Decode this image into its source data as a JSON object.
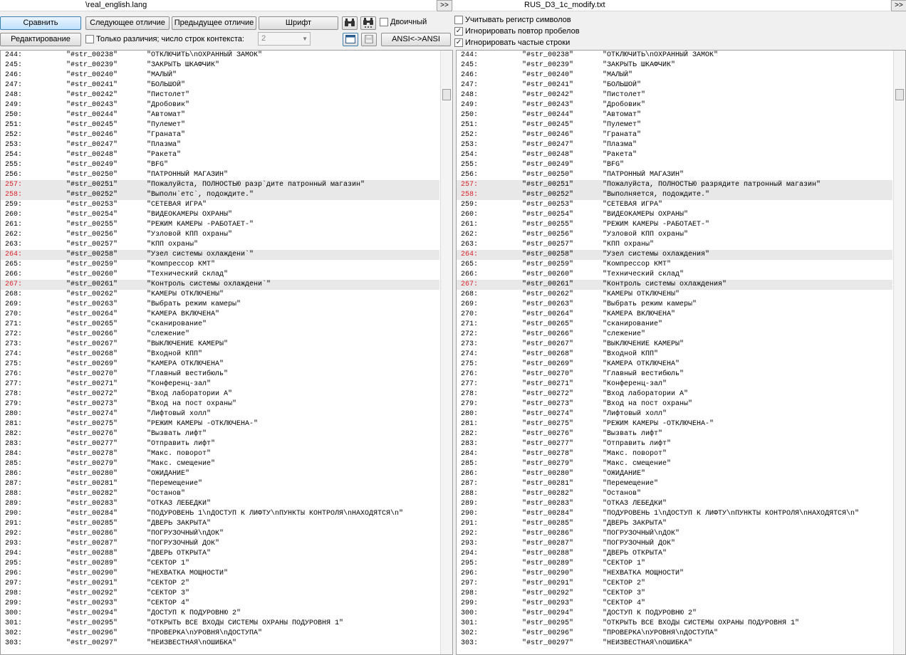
{
  "left_path": "\\real_english.lang",
  "right_path": "RUS_D3_1c_modify.txt",
  "swap_label": ">>",
  "toolbar": {
    "compare": "Сравнить",
    "next_diff": "Следующее отличие",
    "prev_diff": "Предыдущее отличие",
    "font": "Шрифт",
    "edit": "Редактирование",
    "only_diff_label": "Только различия; число строк контекста:",
    "context_value": "2",
    "binary_label": "Двоичный",
    "ansi": "ANSI<->ANSI",
    "find_icon": "binoculars-icon",
    "find_next_icon": "binoculars-next-icon",
    "window_icon": "window-icon",
    "save_icon": "floppy-disk-icon"
  },
  "options": {
    "case_sensitive": "Учитывать регистр символов",
    "ignore_spaces": "Игнорировать повтор пробелов",
    "ignore_frequent": "Игнорировать частые строки"
  },
  "colors": {
    "diff_num": "#d8222a",
    "diff_char": "#e0262e",
    "diff_bg": "#e8e8e8"
  },
  "left_lines": [
    [
      "244:",
      "\"#str_00238\"",
      "\"ОТКЛЮЧИТЬ\\nОХРАННЫЙ ЗАМОК\""
    ],
    [
      "245:",
      "\"#str_00239\"",
      "\"ЗАКРЫТЬ ШКАФЧИК\""
    ],
    [
      "246:",
      "\"#str_00240\"",
      "\"МАЛЫЙ\""
    ],
    [
      "247:",
      "\"#str_00241\"",
      "\"БОЛЬШОЙ\""
    ],
    [
      "248:",
      "\"#str_00242\"",
      "\"Пистолет\""
    ],
    [
      "249:",
      "\"#str_00243\"",
      "\"Дробовик\""
    ],
    [
      "250:",
      "\"#str_00244\"",
      "\"Автомат\""
    ],
    [
      "251:",
      "\"#str_00245\"",
      "\"Пулемет\""
    ],
    [
      "252:",
      "\"#str_00246\"",
      "\"Граната\""
    ],
    [
      "253:",
      "\"#str_00247\"",
      "\"Плазма\""
    ],
    [
      "254:",
      "\"#str_00248\"",
      "\"Ракета\""
    ],
    [
      "255:",
      "\"#str_00249\"",
      "\"BFG\""
    ],
    [
      "256:",
      "\"#str_00250\"",
      "\"ПАТРОННЫЙ МАГАЗИН\""
    ],
    [
      "257:",
      "\"#str_00251\"",
      "\"Пожалуйста, ПОЛНОСТЬЮ разр`дите патронный магазин\""
    ],
    [
      "258:",
      "\"#str_00252\"",
      "\"Выполн`етс`, подождите.\""
    ],
    [
      "259:",
      "\"#str_00253\"",
      "\"СЕТЕВАЯ ИГРА\""
    ],
    [
      "260:",
      "\"#str_00254\"",
      "\"ВИДЕОКАМЕРЫ ОХРАНЫ\""
    ],
    [
      "261:",
      "\"#str_00255\"",
      "\"РЕЖИМ КАМЕРЫ -РАБОТАЕТ-\""
    ],
    [
      "262:",
      "\"#str_00256\"",
      "\"Узловой КПП охраны\""
    ],
    [
      "263:",
      "\"#str_00257\"",
      "\"КПП охраны\""
    ],
    [
      "264:",
      "\"#str_00258\"",
      "\"Узел системы охлаждени`\""
    ],
    [
      "265:",
      "\"#str_00259\"",
      "\"Компрессор КМТ\""
    ],
    [
      "266:",
      "\"#str_00260\"",
      "\"Технический склад\""
    ],
    [
      "267:",
      "\"#str_00261\"",
      "\"Контроль системы охлаждени`\""
    ],
    [
      "268:",
      "\"#str_00262\"",
      "\"КАМЕРЫ ОТКЛЮЧЕНЫ\""
    ],
    [
      "269:",
      "\"#str_00263\"",
      "\"Выбрать режим камеры\""
    ],
    [
      "270:",
      "\"#str_00264\"",
      "\"КАМЕРА ВКЛЮЧЕНА\""
    ],
    [
      "271:",
      "\"#str_00265\"",
      "\"сканирование\""
    ],
    [
      "272:",
      "\"#str_00266\"",
      "\"слежение\""
    ],
    [
      "273:",
      "\"#str_00267\"",
      "\"ВЫКЛЮЧЕНИЕ КАМЕРЫ\""
    ],
    [
      "274:",
      "\"#str_00268\"",
      "\"Входной КПП\""
    ],
    [
      "275:",
      "\"#str_00269\"",
      "\"КАМЕРА ОТКЛЮЧЕНА\""
    ],
    [
      "276:",
      "\"#str_00270\"",
      "\"Главный вестибюль\""
    ],
    [
      "277:",
      "\"#str_00271\"",
      "\"Конференц-зал\""
    ],
    [
      "278:",
      "\"#str_00272\"",
      "\"Вход лаборатории А\""
    ],
    [
      "279:",
      "\"#str_00273\"",
      "\"Вход на пост охраны\""
    ],
    [
      "280:",
      "\"#str_00274\"",
      "\"Лифтовый холл\""
    ],
    [
      "281:",
      "\"#str_00275\"",
      "\"РЕЖИМ КАМЕРЫ -ОТКЛЮЧЕНА-\""
    ],
    [
      "282:",
      "\"#str_00276\"",
      "\"Вызвать лифт\""
    ],
    [
      "283:",
      "\"#str_00277\"",
      "\"Отправить лифт\""
    ],
    [
      "284:",
      "\"#str_00278\"",
      "\"Макс. поворот\""
    ],
    [
      "285:",
      "\"#str_00279\"",
      "\"Макс. смещение\""
    ],
    [
      "286:",
      "\"#str_00280\"",
      "\"ОЖИДАНИЕ\""
    ],
    [
      "287:",
      "\"#str_00281\"",
      "\"Перемещение\""
    ],
    [
      "288:",
      "\"#str_00282\"",
      "\"Останов\""
    ],
    [
      "289:",
      "\"#str_00283\"",
      "\"ОТКАЗ ЛЕБЕДКИ\""
    ],
    [
      "290:",
      "\"#str_00284\"",
      "\"ПОДУРОВЕНЬ 1\\nДОСТУП К ЛИФТУ\\nПУНКТЫ КОНТРОЛЯ\\nНАХОДЯТСЯ\\n\""
    ],
    [
      "291:",
      "\"#str_00285\"",
      "\"ДВЕРЬ ЗАКРЫТА\""
    ],
    [
      "292:",
      "\"#str_00286\"",
      "\"ПОГРУЗОЧНЫЙ\\nДОК\""
    ],
    [
      "293:",
      "\"#str_00287\"",
      "\"ПОГРУЗОЧНЫЙ ДОК\""
    ],
    [
      "294:",
      "\"#str_00288\"",
      "\"ДВЕРЬ ОТКРЫТА\""
    ],
    [
      "295:",
      "\"#str_00289\"",
      "\"СЕКТОР 1\""
    ],
    [
      "296:",
      "\"#str_00290\"",
      "\"НЕХВАТКА МОЩНОСТИ\""
    ],
    [
      "297:",
      "\"#str_00291\"",
      "\"СЕКТОР 2\""
    ],
    [
      "298:",
      "\"#str_00292\"",
      "\"СЕКТОР 3\""
    ],
    [
      "299:",
      "\"#str_00293\"",
      "\"СЕКТОР 4\""
    ],
    [
      "300:",
      "\"#str_00294\"",
      "\"ДОСТУП К ПОДУРОВНЮ 2\""
    ],
    [
      "301:",
      "\"#str_00295\"",
      "\"ОТКРЫТЬ ВСЕ ВХОДЫ СИСТЕМЫ ОХРАНЫ ПОДУРОВНЯ 1\""
    ],
    [
      "302:",
      "\"#str_00296\"",
      "\"ПРОВЕРКА\\nУРОВНЯ\\nДОСТУПА\""
    ],
    [
      "303:",
      "\"#str_00297\"",
      "\"НЕИЗВЕСТНАЯ\\nОШИБКА\""
    ]
  ],
  "right_lines": [
    [
      "244:",
      "\"#str_00238\"",
      "\"ОТКЛЮЧИТЬ\\nОХРАННЫЙ ЗАМОК\""
    ],
    [
      "245:",
      "\"#str_00239\"",
      "\"ЗАКРЫТЬ ШКАФЧИК\""
    ],
    [
      "246:",
      "\"#str_00240\"",
      "\"МАЛЫЙ\""
    ],
    [
      "247:",
      "\"#str_00241\"",
      "\"БОЛЬШОЙ\""
    ],
    [
      "248:",
      "\"#str_00242\"",
      "\"Пистолет\""
    ],
    [
      "249:",
      "\"#str_00243\"",
      "\"Дробовик\""
    ],
    [
      "250:",
      "\"#str_00244\"",
      "\"Автомат\""
    ],
    [
      "251:",
      "\"#str_00245\"",
      "\"Пулемет\""
    ],
    [
      "252:",
      "\"#str_00246\"",
      "\"Граната\""
    ],
    [
      "253:",
      "\"#str_00247\"",
      "\"Плазма\""
    ],
    [
      "254:",
      "\"#str_00248\"",
      "\"Ракета\""
    ],
    [
      "255:",
      "\"#str_00249\"",
      "\"BFG\""
    ],
    [
      "256:",
      "\"#str_00250\"",
      "\"ПАТРОННЫЙ МАГАЗИН\""
    ],
    [
      "257:",
      "\"#str_00251\"",
      "\"Пожалуйста, ПОЛНОСТЬЮ разрядите патронный магазин\""
    ],
    [
      "258:",
      "\"#str_00252\"",
      "\"Выполняется, подождите.\""
    ],
    [
      "259:",
      "\"#str_00253\"",
      "\"СЕТЕВАЯ ИГРА\""
    ],
    [
      "260:",
      "\"#str_00254\"",
      "\"ВИДЕОКАМЕРЫ ОХРАНЫ\""
    ],
    [
      "261:",
      "\"#str_00255\"",
      "\"РЕЖИМ КАМЕРЫ -РАБОТАЕТ-\""
    ],
    [
      "262:",
      "\"#str_00256\"",
      "\"Узловой КПП охраны\""
    ],
    [
      "263:",
      "\"#str_00257\"",
      "\"КПП охраны\""
    ],
    [
      "264:",
      "\"#str_00258\"",
      "\"Узел системы охлаждения\""
    ],
    [
      "265:",
      "\"#str_00259\"",
      "\"Компрессор КМТ\""
    ],
    [
      "266:",
      "\"#str_00260\"",
      "\"Технический склад\""
    ],
    [
      "267:",
      "\"#str_00261\"",
      "\"Контроль системы охлаждения\""
    ],
    [
      "268:",
      "\"#str_00262\"",
      "\"КАМЕРЫ ОТКЛЮЧЕНЫ\""
    ],
    [
      "269:",
      "\"#str_00263\"",
      "\"Выбрать режим камеры\""
    ],
    [
      "270:",
      "\"#str_00264\"",
      "\"КАМЕРА ВКЛЮЧЕНА\""
    ],
    [
      "271:",
      "\"#str_00265\"",
      "\"сканирование\""
    ],
    [
      "272:",
      "\"#str_00266\"",
      "\"слежение\""
    ],
    [
      "273:",
      "\"#str_00267\"",
      "\"ВЫКЛЮЧЕНИЕ КАМЕРЫ\""
    ],
    [
      "274:",
      "\"#str_00268\"",
      "\"Входной КПП\""
    ],
    [
      "275:",
      "\"#str_00269\"",
      "\"КАМЕРА ОТКЛЮЧЕНА\""
    ],
    [
      "276:",
      "\"#str_00270\"",
      "\"Главный вестибюль\""
    ],
    [
      "277:",
      "\"#str_00271\"",
      "\"Конференц-зал\""
    ],
    [
      "278:",
      "\"#str_00272\"",
      "\"Вход лаборатории А\""
    ],
    [
      "279:",
      "\"#str_00273\"",
      "\"Вход на пост охраны\""
    ],
    [
      "280:",
      "\"#str_00274\"",
      "\"Лифтовый холл\""
    ],
    [
      "281:",
      "\"#str_00275\"",
      "\"РЕЖИМ КАМЕРЫ -ОТКЛЮЧЕНА-\""
    ],
    [
      "282:",
      "\"#str_00276\"",
      "\"Вызвать лифт\""
    ],
    [
      "283:",
      "\"#str_00277\"",
      "\"Отправить лифт\""
    ],
    [
      "284:",
      "\"#str_00278\"",
      "\"Макс. поворот\""
    ],
    [
      "285:",
      "\"#str_00279\"",
      "\"Макс. смещение\""
    ],
    [
      "286:",
      "\"#str_00280\"",
      "\"ОЖИДАНИЕ\""
    ],
    [
      "287:",
      "\"#str_00281\"",
      "\"Перемещение\""
    ],
    [
      "288:",
      "\"#str_00282\"",
      "\"Останов\""
    ],
    [
      "289:",
      "\"#str_00283\"",
      "\"ОТКАЗ ЛЕБЕДКИ\""
    ],
    [
      "290:",
      "\"#str_00284\"",
      "\"ПОДУРОВЕНЬ 1\\nДОСТУП К ЛИФТУ\\nПУНКТЫ КОНТРОЛЯ\\nНАХОДЯТСЯ\\n\""
    ],
    [
      "291:",
      "\"#str_00285\"",
      "\"ДВЕРЬ ЗАКРЫТА\""
    ],
    [
      "292:",
      "\"#str_00286\"",
      "\"ПОГРУЗОЧНЫЙ\\nДОК\""
    ],
    [
      "293:",
      "\"#str_00287\"",
      "\"ПОГРУЗОЧНЫЙ ДОК\""
    ],
    [
      "294:",
      "\"#str_00288\"",
      "\"ДВЕРЬ ОТКРЫТА\""
    ],
    [
      "295:",
      "\"#str_00289\"",
      "\"СЕКТОР 1\""
    ],
    [
      "296:",
      "\"#str_00290\"",
      "\"НЕХВАТКА МОЩНОСТИ\""
    ],
    [
      "297:",
      "\"#str_00291\"",
      "\"СЕКТОР 2\""
    ],
    [
      "298:",
      "\"#str_00292\"",
      "\"СЕКТОР 3\""
    ],
    [
      "299:",
      "\"#str_00293\"",
      "\"СЕКТОР 4\""
    ],
    [
      "300:",
      "\"#str_00294\"",
      "\"ДОСТУП К ПОДУРОВНЮ 2\""
    ],
    [
      "301:",
      "\"#str_00295\"",
      "\"ОТКРЫТЬ ВСЕ ВХОДЫ СИСТЕМЫ ОХРАНЫ ПОДУРОВНЯ 1\""
    ],
    [
      "302:",
      "\"#str_00296\"",
      "\"ПРОВЕРКА\\nУРОВНЯ\\nДОСТУПА\""
    ],
    [
      "303:",
      "\"#str_00297\"",
      "\"НЕИЗВЕСТНАЯ\\nОШИБКА\""
    ]
  ],
  "diff_lines": [
    "257:",
    "258:",
    "264:",
    "267:"
  ]
}
